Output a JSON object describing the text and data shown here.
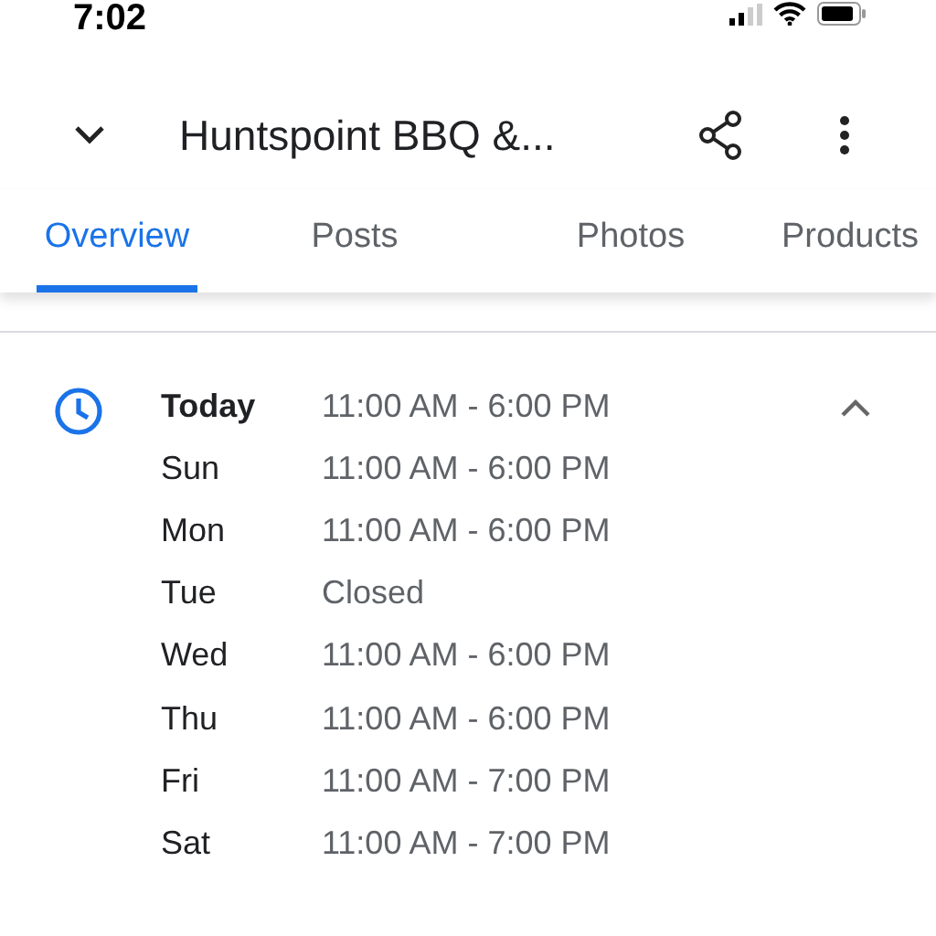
{
  "status_bar": {
    "time": "7:02"
  },
  "header": {
    "title": "Huntspoint BBQ &..."
  },
  "tabs": [
    {
      "label": "Overview",
      "selected": true
    },
    {
      "label": "Posts",
      "selected": false
    },
    {
      "label": "Photos",
      "selected": false
    },
    {
      "label": "Products",
      "selected": false
    }
  ],
  "hours": {
    "expanded": true,
    "rows": [
      {
        "day": "Today",
        "time": "11:00 AM - 6:00 PM",
        "selected": true
      },
      {
        "day": "Sun",
        "time": "11:00 AM - 6:00 PM",
        "selected": false
      },
      {
        "day": "Mon",
        "time": "11:00 AM - 6:00 PM",
        "selected": false
      },
      {
        "day": "Tue",
        "time": "Closed",
        "selected": false
      },
      {
        "day": "Wed",
        "time": "11:00 AM - 6:00 PM",
        "selected": false
      },
      {
        "day": "Thu",
        "time": "11:00 AM - 6:00 PM",
        "selected": false
      },
      {
        "day": "Fri",
        "time": "11:00 AM - 7:00 PM",
        "selected": false
      },
      {
        "day": "Sat",
        "time": "11:00 AM - 7:00 PM",
        "selected": false
      }
    ]
  }
}
